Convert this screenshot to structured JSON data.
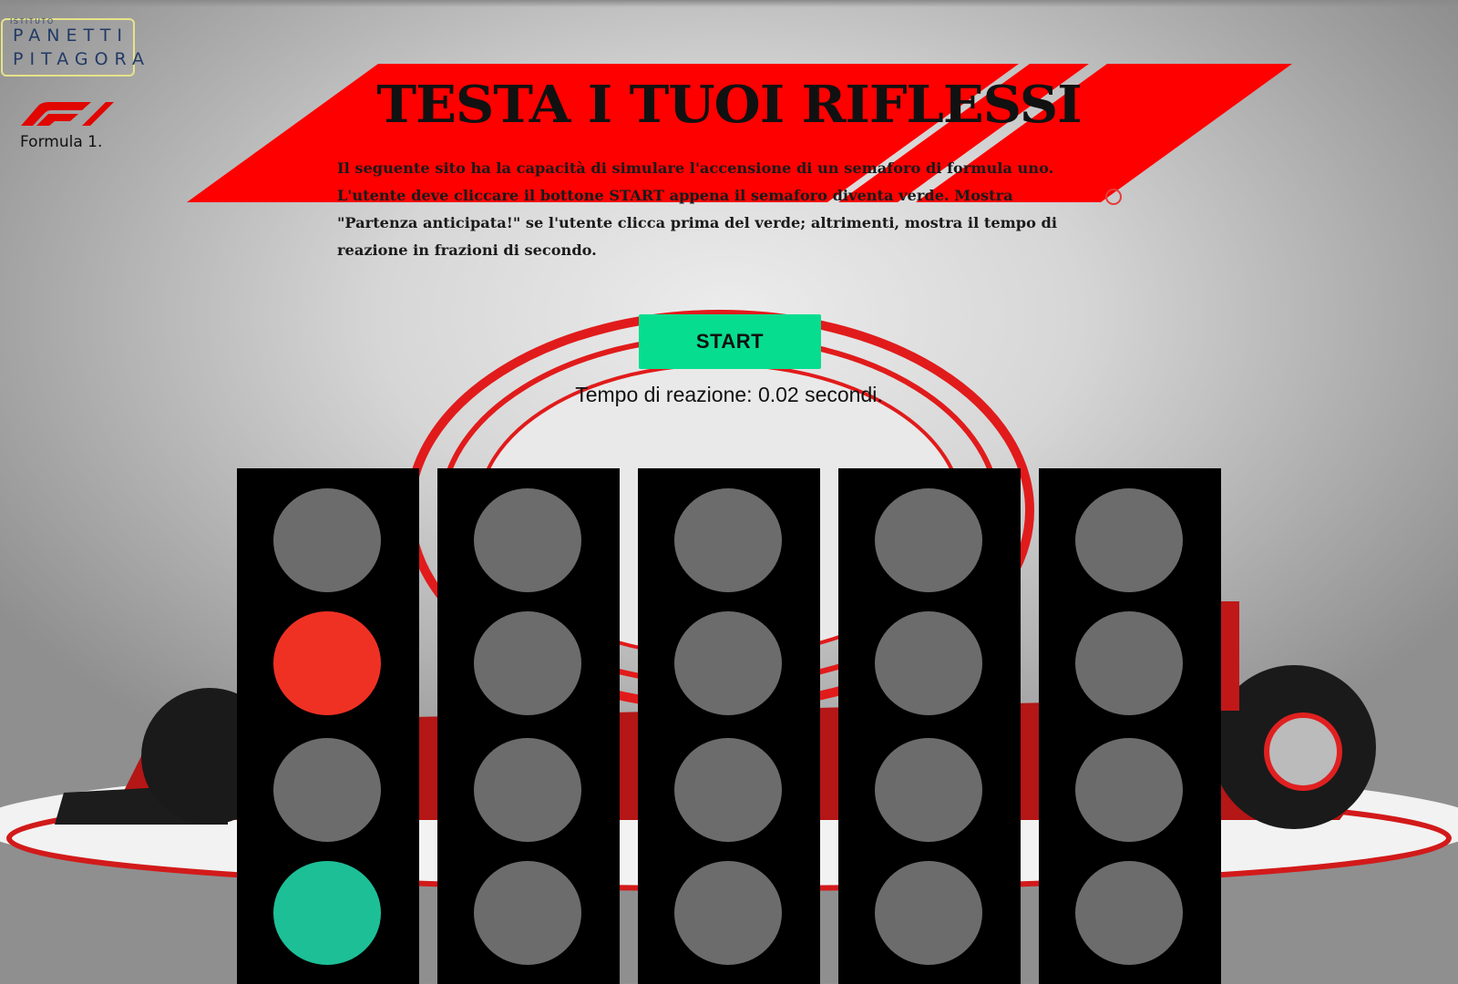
{
  "header": {
    "school_logo": {
      "small": "ISTITUTO",
      "line1": "PANETTI",
      "line2": "PITAGORA"
    },
    "brand_logo_text": "Formula 1.",
    "title": "TESTA I TUOI RIFLESSI",
    "description": "Il seguente sito ha la capacità di simulare l'accensione di un semaforo di formula uno. L'utente deve cliccare il bottone START appena il semaforo diventa verde. Mostra \"Partenza anticipata!\" se l'utente clicca prima del verde; altrimenti, mostra il tempo di reazione in frazioni di secondo."
  },
  "controls": {
    "start_label": "START",
    "reaction_text": "Tempo di reazione: 0.02 secondi."
  },
  "traffic_lights": {
    "off_color": "#6c6c6c",
    "panels": [
      [
        "off",
        "red",
        "off",
        "green"
      ],
      [
        "off",
        "off",
        "off",
        "off"
      ],
      [
        "off",
        "off",
        "off",
        "off"
      ],
      [
        "off",
        "off",
        "off",
        "off"
      ],
      [
        "off",
        "off",
        "off",
        "off"
      ]
    ],
    "colors": {
      "red": "#ef3124",
      "green": "#1dbf97",
      "off": "#6c6c6c"
    }
  },
  "theme": {
    "accent_red": "#ff0000",
    "start_green": "#07dd8f"
  }
}
